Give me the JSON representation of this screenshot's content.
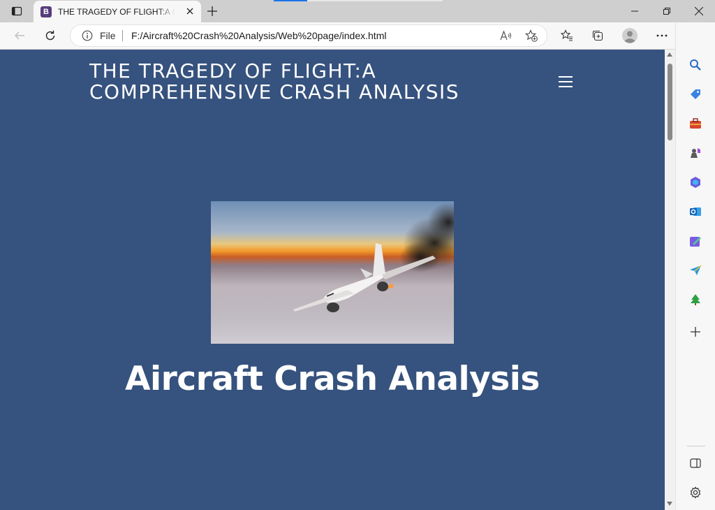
{
  "browser": {
    "tab": {
      "favicon_letter": "B",
      "title": "THE TRAGEDY OF FLIGHT:A Comprehensive Crash Analysis"
    },
    "address": {
      "scheme_label": "File",
      "url": "F:/Aircraft%20Crash%20Analysis/Web%20page/index.html"
    },
    "toolbar_icons": [
      "back-icon",
      "refresh-icon",
      "read-aloud-icon",
      "add-favorite-icon",
      "favorites-icon",
      "collections-icon",
      "profile-icon",
      "more-icon",
      "bing-icon"
    ],
    "sidebar_icons": [
      "search-icon",
      "shopping-icon",
      "tools-icon",
      "games-icon",
      "microsoft365-icon",
      "outlook-icon",
      "designer-icon",
      "drop-icon",
      "tree-icon",
      "add-icon",
      "hide-sidebar-icon",
      "settings-icon"
    ]
  },
  "page": {
    "site_title": "THE TRAGEDY OF FLIGHT:A COMPREHENSIVE CRASH ANALYSIS",
    "hero_heading": "Aircraft Crash Analysis",
    "colors": {
      "background": "#36527e",
      "text": "#ffffff"
    }
  }
}
